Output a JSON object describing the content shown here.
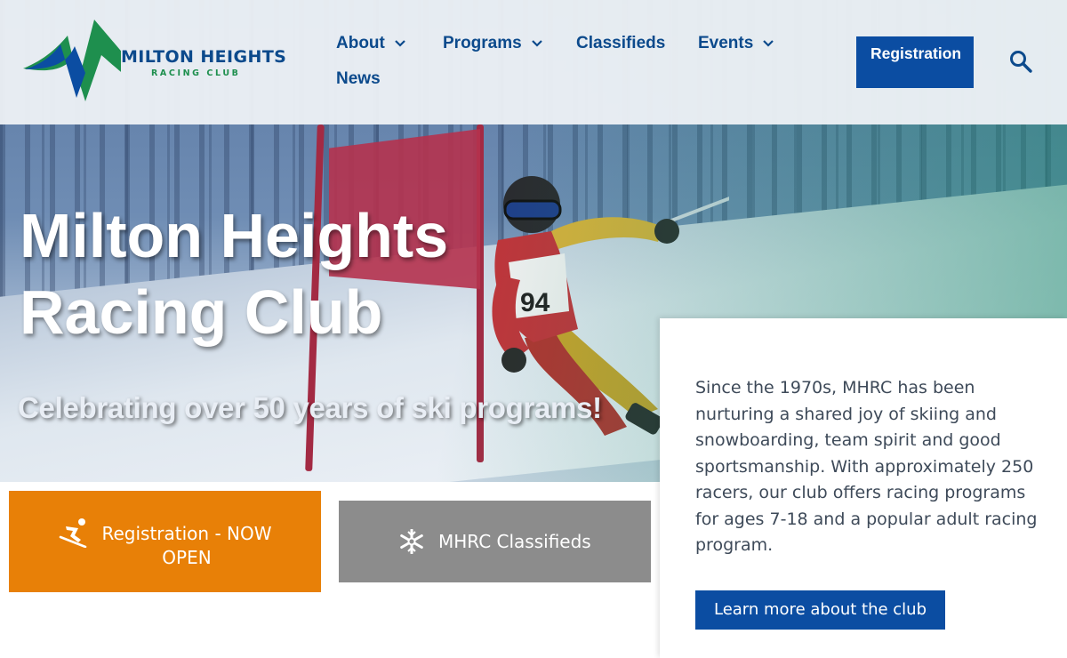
{
  "site": {
    "logo_title": "MILTON HEIGHTS",
    "logo_subtitle": "RACING CLUB"
  },
  "nav": {
    "items": [
      {
        "label": "About",
        "has_dropdown": true
      },
      {
        "label": "Programs",
        "has_dropdown": true
      },
      {
        "label": "Classifieds",
        "has_dropdown": false
      },
      {
        "label": "Events",
        "has_dropdown": true
      },
      {
        "label": "News",
        "has_dropdown": false
      }
    ],
    "registration_label": "Registration",
    "search_icon": "search-icon"
  },
  "hero": {
    "title_line1": "Milton Heights",
    "title_line2": "Racing Club",
    "subtitle": "Celebrating over 50 years of ski programs!",
    "racer_bib": "94"
  },
  "cta": {
    "registration_label": "Registration - NOW OPEN",
    "registration_icon": "skier-icon",
    "classifieds_label": "MHRC Classifieds",
    "classifieds_icon": "snowflake-icon"
  },
  "about": {
    "text": "Since the 1970s, MHRC has been nurturing a shared joy of skiing and snowboarding, team spirit and good sportsmanship. With approximately 250 racers, our club offers racing programs for ages 7-18 and a popular adult racing program.",
    "button_label": "Learn more about the club"
  },
  "colors": {
    "brand_blue": "#0b4da2",
    "nav_text": "#0c4a8c",
    "logo_green": "#1e8f4e",
    "cta_orange": "#e88007",
    "cta_grey": "#8c8c8c"
  }
}
